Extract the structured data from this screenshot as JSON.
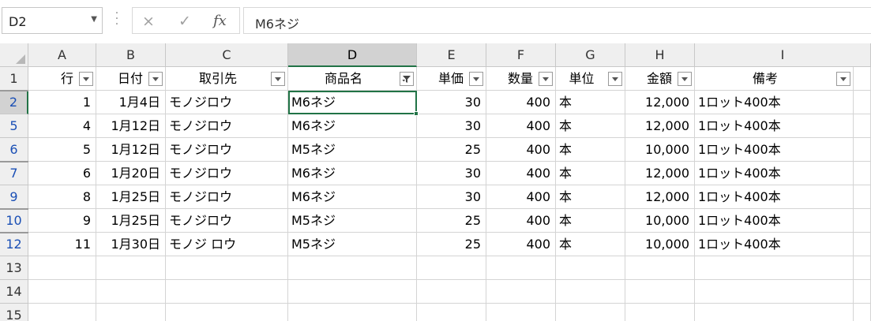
{
  "formula_bar": {
    "name_box": "D2",
    "formula": "M6ネジ",
    "cancel_icon": "×",
    "enter_icon": "✓",
    "fx_label": "fx"
  },
  "columns": [
    "A",
    "B",
    "C",
    "D",
    "E",
    "F",
    "G",
    "H",
    "I"
  ],
  "selected_column": "D",
  "header_row": {
    "row_number": "1",
    "labels": [
      "行",
      "日付",
      "取引先",
      "商品名",
      "単価",
      "数量",
      "単位",
      "金額",
      "備考"
    ],
    "filtered_column": "D"
  },
  "rows": [
    {
      "row_number": "2",
      "cells": [
        "1",
        "1月4日",
        "モノジロウ",
        "M6ネジ",
        "30",
        "400",
        "本",
        "12,000",
        "1ロット400本"
      ]
    },
    {
      "row_number": "5",
      "cells": [
        "4",
        "1月12日",
        "モノジロウ",
        "M6ネジ",
        "30",
        "400",
        "本",
        "12,000",
        "1ロット400本"
      ]
    },
    {
      "row_number": "6",
      "cells": [
        "5",
        "1月12日",
        "モノジロウ",
        "M5ネジ",
        "25",
        "400",
        "本",
        "10,000",
        "1ロット400本"
      ]
    },
    {
      "row_number": "7",
      "cells": [
        "6",
        "1月20日",
        "モノジロウ",
        "M6ネジ",
        "30",
        "400",
        "本",
        "12,000",
        "1ロット400本"
      ]
    },
    {
      "row_number": "9",
      "cells": [
        "8",
        "1月25日",
        "モノジロウ",
        "M6ネジ",
        "30",
        "400",
        "本",
        "12,000",
        "1ロット400本"
      ]
    },
    {
      "row_number": "10",
      "cells": [
        "9",
        "1月25日",
        "モノジロウ",
        "M5ネジ",
        "25",
        "400",
        "本",
        "10,000",
        "1ロット400本"
      ]
    },
    {
      "row_number": "12",
      "cells": [
        "11",
        "1月30日",
        "モノジ ロウ",
        "M5ネジ",
        "25",
        "400",
        "本",
        "10,000",
        "1ロット400本"
      ]
    }
  ],
  "empty_rows": [
    "13",
    "14",
    "15"
  ],
  "active_cell": "D2",
  "colors": {
    "selection_green": "#217346",
    "filtered_row_number": "#1a4fb5",
    "header_bg": "#efefef"
  }
}
